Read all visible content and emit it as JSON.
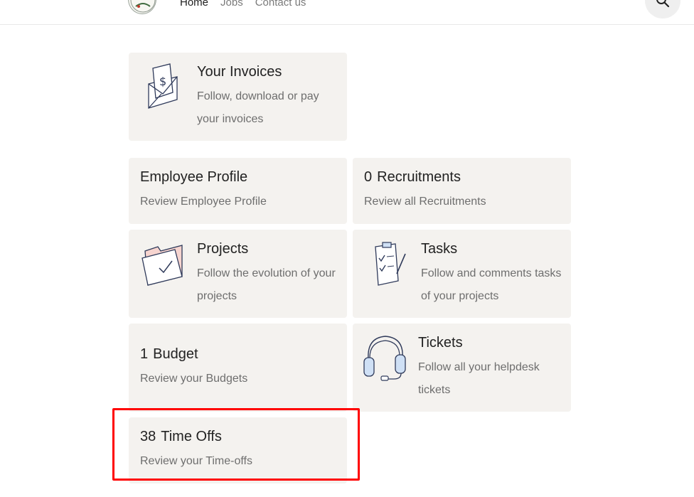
{
  "nav": {
    "links": [
      {
        "label": "Home"
      },
      {
        "label": "Jobs"
      },
      {
        "label": "Contact us"
      }
    ]
  },
  "cards": {
    "invoices": {
      "title": "Your Invoices",
      "desc": "Follow, download or pay your invoices",
      "icon": "invoice-envelope-icon"
    },
    "employee": {
      "title": "Employee Profile",
      "desc": "Review Employee Profile"
    },
    "recruitments": {
      "count": "0",
      "title": "Recruitments",
      "desc": "Review all Recruitments"
    },
    "projects": {
      "title": "Projects",
      "desc": "Follow the evolution of your projects",
      "icon": "folder-check-icon"
    },
    "tasks": {
      "title": "Tasks",
      "desc": "Follow and comments tasks of your projects",
      "icon": "clipboard-checklist-icon"
    },
    "budget": {
      "count": "1",
      "title": "Budget",
      "desc": "Review your Budgets"
    },
    "tickets": {
      "title": "Tickets",
      "desc": "Follow all your helpdesk tickets",
      "icon": "headset-icon"
    },
    "timeoffs": {
      "count": "38",
      "title": "Time Offs",
      "desc": "Review your Time-offs"
    }
  },
  "colors": {
    "card_bg": "#f4f2ef",
    "highlight": "#ff0000",
    "icon_stroke": "#2f3a5a",
    "icon_accent_pink": "#f6d4cf",
    "icon_accent_blue": "#cfe0f5"
  }
}
